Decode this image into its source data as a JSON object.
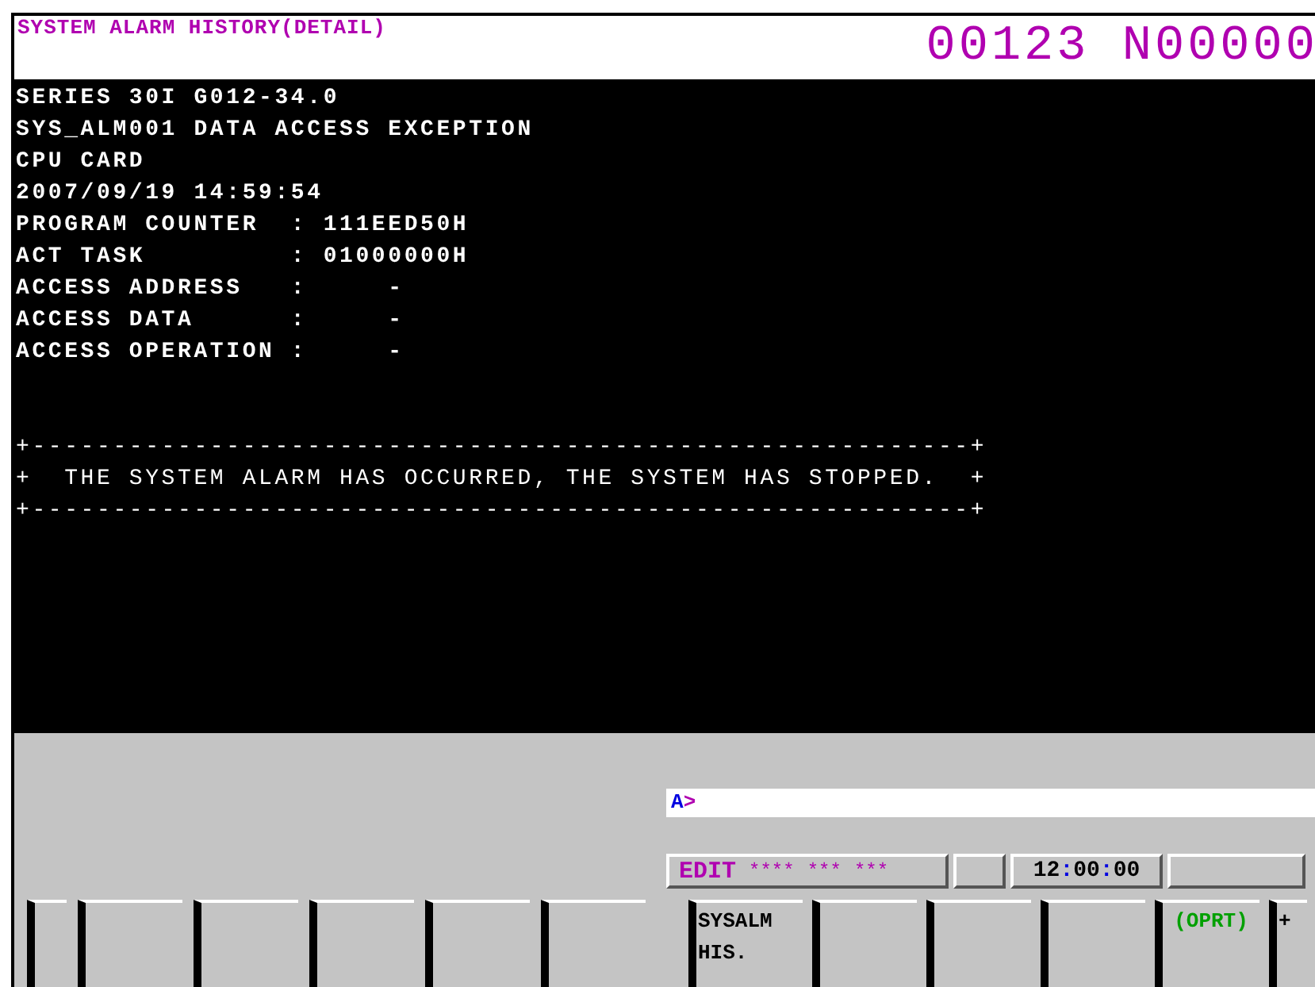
{
  "header": {
    "title": "SYSTEM ALARM HISTORY(DETAIL)",
    "program_number": "00123 N00000"
  },
  "detail_lines": [
    "SERIES 30I G012-34.0",
    "SYS_ALM001 DATA ACCESS EXCEPTION",
    "CPU CARD",
    "2007/09/19 14:59:54",
    "PROGRAM COUNTER  : 111EED50H",
    "ACT TASK         : 01000000H",
    "ACCESS ADDRESS   :     -",
    "ACCESS DATA      :     -",
    "ACCESS OPERATION :     -"
  ],
  "message_box": [
    "+----------------------------------------------------------+",
    "+  THE SYSTEM ALARM HAS OCCURRED, THE SYSTEM HAS STOPPED.  +",
    "+----------------------------------------------------------+"
  ],
  "input_line": {
    "prompt_letter": "A",
    "prompt_mark": ">"
  },
  "status": {
    "mode": "EDIT",
    "fields": [
      "****",
      "***",
      "***"
    ],
    "time_parts": [
      "12",
      "00",
      "00"
    ],
    "time_separator": ":"
  },
  "soft_keys_left": [
    {
      "kind": "return"
    },
    {
      "kind": "blank"
    },
    {
      "kind": "blank"
    },
    {
      "kind": "blank"
    },
    {
      "kind": "blank"
    },
    {
      "kind": "blank"
    }
  ],
  "soft_keys_right": [
    {
      "kind": "page",
      "label": "SYSALM HIS."
    },
    {
      "kind": "blank"
    },
    {
      "kind": "blank"
    },
    {
      "kind": "blank"
    },
    {
      "kind": "operation",
      "label": "(OPRT)"
    },
    {
      "kind": "next",
      "label": "+"
    }
  ]
}
